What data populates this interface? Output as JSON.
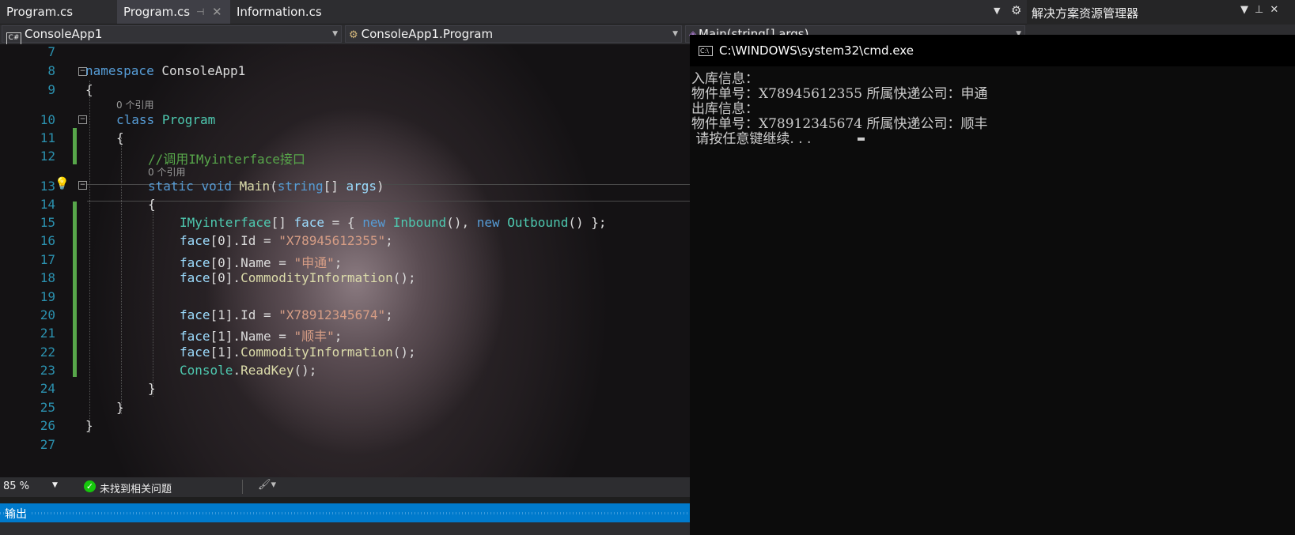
{
  "tabs": [
    {
      "label": "Program.cs",
      "active": false
    },
    {
      "label": "Program.cs",
      "active": true
    },
    {
      "label": "Information.cs",
      "active": false
    }
  ],
  "nav": {
    "project": "ConsoleApp1",
    "class": "ConsoleApp1.Program",
    "member": "Main(string[] args)"
  },
  "solution_explorer": {
    "title": "解决方案资源管理器"
  },
  "editor": {
    "line_numbers": [
      "7",
      "8",
      "9",
      "10",
      "11",
      "12",
      "13",
      "14",
      "15",
      "16",
      "17",
      "18",
      "19",
      "20",
      "21",
      "22",
      "23",
      "24",
      "25",
      "26",
      "27"
    ],
    "ref_hint_class": "0 个引用",
    "ref_hint_main": "0 个引用",
    "lines": {
      "l8": [
        "namespace",
        " ConsoleApp1"
      ],
      "l9": "{",
      "l10": [
        "class",
        " ",
        "Program"
      ],
      "l11": "{",
      "l12": "//调用IMyinterface接口",
      "l13": [
        "static",
        " ",
        "void",
        " ",
        "Main",
        "(",
        "string",
        "[] ",
        "args",
        ")"
      ],
      "l14": "{",
      "l15": [
        "IMyinterface",
        "[] ",
        "face",
        " = { ",
        "new",
        " ",
        "Inbound",
        "(), ",
        "new",
        " ",
        "Outbound",
        "() };"
      ],
      "l16": [
        "face",
        "[0].",
        "Id",
        " = ",
        "\"X78945612355\"",
        ";"
      ],
      "l17": [
        "face",
        "[0].",
        "Name",
        " = ",
        "\"申通\"",
        ";"
      ],
      "l18": [
        "face",
        "[0].",
        "CommodityInformation",
        "();"
      ],
      "l20": [
        "face",
        "[1].",
        "Id",
        " = ",
        "\"X78912345674\"",
        ";"
      ],
      "l21": [
        "face",
        "[1].",
        "Name",
        " = ",
        "\"顺丰\"",
        ";"
      ],
      "l22": [
        "face",
        "[1].",
        "CommodityInformation",
        "();"
      ],
      "l23": [
        "Console",
        ".",
        "ReadKey",
        "();"
      ],
      "l24": "}",
      "l25": "}",
      "l26": "}"
    }
  },
  "status": {
    "zoom": "85 %",
    "issues": "未找到相关问题"
  },
  "output": {
    "label": "输出"
  },
  "cmd": {
    "title": "C:\\WINDOWS\\system32\\cmd.exe",
    "lines": [
      "入库信息：",
      "物件单号：X78945612355 所属快递公司：申通",
      "出库信息：",
      "物件单号：X78912345674 所属快递公司：顺丰",
      " 请按任意键继续. . . "
    ]
  },
  "colors": {
    "keyword": "#569cd6",
    "type": "#4ec9b0",
    "string": "#d69d85",
    "comment": "#57a64a",
    "accent": "#007acc"
  }
}
